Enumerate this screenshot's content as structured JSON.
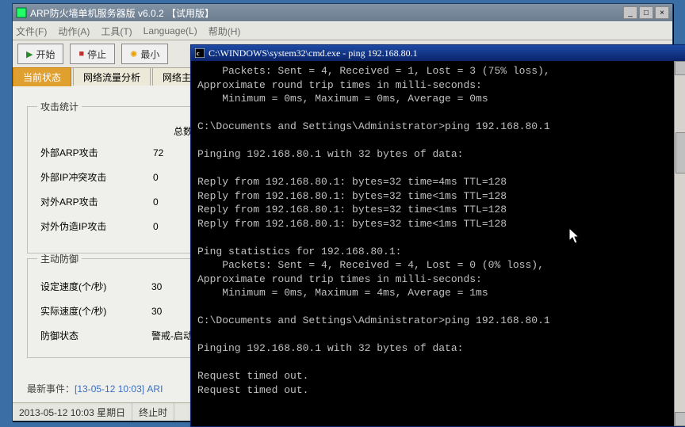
{
  "app": {
    "title": "ARP防火墙单机服务器版  v6.0.2 【试用版】"
  },
  "menu": {
    "file": "文件(F)",
    "action": "动作(A)",
    "tools": "工具(T)",
    "language": "Language(L)",
    "help": "帮助(H)"
  },
  "toolbar": {
    "start": "开始",
    "stop": "停止",
    "min": "最小"
  },
  "tabs": {
    "current": "当前状态",
    "traffic": "网络流量分析",
    "hosts": "网络主"
  },
  "window_buttons": {
    "min": "_",
    "max": "□",
    "close": "×"
  },
  "stats": {
    "legend": "攻击统计",
    "total_header": "总数",
    "rows": [
      {
        "label": "外部ARP攻击",
        "value": "72"
      },
      {
        "label": "外部IP冲突攻击",
        "value": "0"
      },
      {
        "label": "对外ARP攻击",
        "value": "0"
      },
      {
        "label": "对外伪造IP攻击",
        "value": "0"
      }
    ]
  },
  "defense": {
    "legend": "主动防御",
    "rows": [
      {
        "label": "设定速度(个/秒)",
        "value": "30"
      },
      {
        "label": "实际速度(个/秒)",
        "value": "30"
      },
      {
        "label": "防御状态",
        "value": "警戒-启动"
      }
    ]
  },
  "lastevent": {
    "prefix": "最新事件：",
    "text": "[13-05-12 10:03] ARI"
  },
  "statusbar": {
    "time": "2013-05-12 10:03 星期日",
    "end": "终止时"
  },
  "cmd": {
    "title": "C:\\WINDOWS\\system32\\cmd.exe - ping 192.168.80.1",
    "lines": [
      "    Packets: Sent = 4, Received = 1, Lost = 3 (75% loss),",
      "Approximate round trip times in milli-seconds:",
      "    Minimum = 0ms, Maximum = 0ms, Average = 0ms",
      "",
      "C:\\Documents and Settings\\Administrator>ping 192.168.80.1",
      "",
      "Pinging 192.168.80.1 with 32 bytes of data:",
      "",
      "Reply from 192.168.80.1: bytes=32 time=4ms TTL=128",
      "Reply from 192.168.80.1: bytes=32 time<1ms TTL=128",
      "Reply from 192.168.80.1: bytes=32 time<1ms TTL=128",
      "Reply from 192.168.80.1: bytes=32 time<1ms TTL=128",
      "",
      "Ping statistics for 192.168.80.1:",
      "    Packets: Sent = 4, Received = 4, Lost = 0 (0% loss),",
      "Approximate round trip times in milli-seconds:",
      "    Minimum = 0ms, Maximum = 4ms, Average = 1ms",
      "",
      "C:\\Documents and Settings\\Administrator>ping 192.168.80.1",
      "",
      "Pinging 192.168.80.1 with 32 bytes of data:",
      "",
      "Request timed out.",
      "Request timed out."
    ]
  }
}
